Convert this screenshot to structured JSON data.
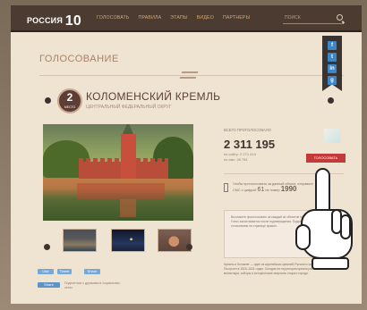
{
  "header": {
    "logo_text": "РОССИЯ",
    "logo_number": "10",
    "nav": [
      "ГОЛОСОВАТЬ",
      "ПРАВИЛА",
      "ЭТАПЫ",
      "ВИДЕО",
      "ПАРТНЕРЫ"
    ],
    "search_placeholder": "ПОИСК"
  },
  "section": {
    "title": "ГОЛОСОВАНИЕ"
  },
  "social_buttons": [
    "f",
    "t",
    "in",
    "g"
  ],
  "item": {
    "rank": "2",
    "rank_caption": "МЕСТО",
    "title": "КОЛОМЕНСКИЙ КРЕМЛЬ",
    "subtitle": "ЦЕНТРАЛЬНЫЙ ФЕДЕРАЛЬНЫЙ ОКРУГ"
  },
  "stats": {
    "label": "ВСЕГО ПРОГОЛОСОВАЛО",
    "total": "2 311 195",
    "line1": "по сайту: 2 271 414",
    "line2": "по смс: 39 781",
    "vote_button": "ГОЛОСОВАТЬ"
  },
  "vote_info": {
    "intro": "Чтобы проголосовать за данный объект, отправьте",
    "sms_prefix": "СМС с цифрой",
    "sms_code": "61",
    "sms_middle": "на номер",
    "sms_number": "1990"
  },
  "notice_text": "Вы можете проголосовать за каждый из объектов только один раз. Голос засчитывается после подтверждения. Подробнее о правилах голосования на странице правил.",
  "description_text": "Кремль в Коломне — один из крупнейших кремлей Русского государства. Построен в 1525–1531 годах. Сегодня на территории кремля расположены монастыри, соборы и исторические кварталы старого города.",
  "share": {
    "like": "Like",
    "tweet": "Tweet",
    "share": "Share",
    "caption": "Поделиться с друзьями в социальных сетях"
  }
}
